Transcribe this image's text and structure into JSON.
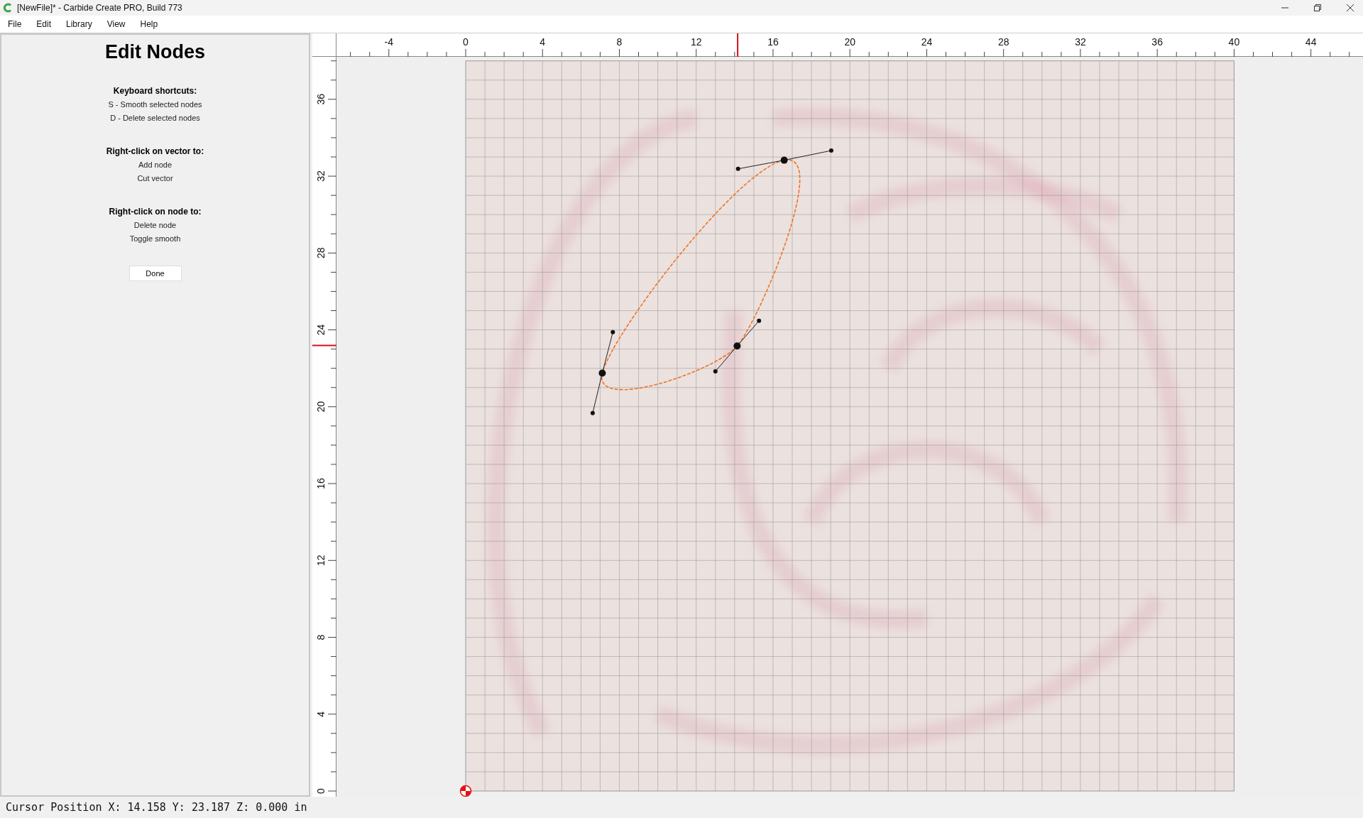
{
  "window": {
    "title": "[NewFile]* - Carbide Create PRO, Build 773"
  },
  "menu": [
    {
      "label": "File"
    },
    {
      "label": "Edit"
    },
    {
      "label": "Library"
    },
    {
      "label": "View"
    },
    {
      "label": "Help"
    }
  ],
  "panel": {
    "title": "Edit Nodes",
    "sections": [
      {
        "heading": "Keyboard shortcuts:",
        "lines": [
          "S - Smooth selected nodes",
          "D - Delete selected nodes"
        ]
      },
      {
        "heading": "Right-click on vector to:",
        "lines": [
          "Add node",
          "Cut vector"
        ]
      },
      {
        "heading": "Right-click on node to:",
        "lines": [
          "Delete node",
          "Toggle smooth"
        ]
      }
    ],
    "done_button": "Done"
  },
  "rulers": {
    "horizontal": [
      "-4",
      "0",
      "4",
      "8",
      "12",
      "16",
      "20",
      "24",
      "28",
      "32",
      "36",
      "40",
      "44"
    ],
    "vertical": [
      "0",
      "4",
      "8",
      "12",
      "16",
      "20",
      "24",
      "28",
      "32",
      "36"
    ]
  },
  "status_bar": "Cursor Position X: 14.158 Y: 23.187 Z: 0.000 in"
}
